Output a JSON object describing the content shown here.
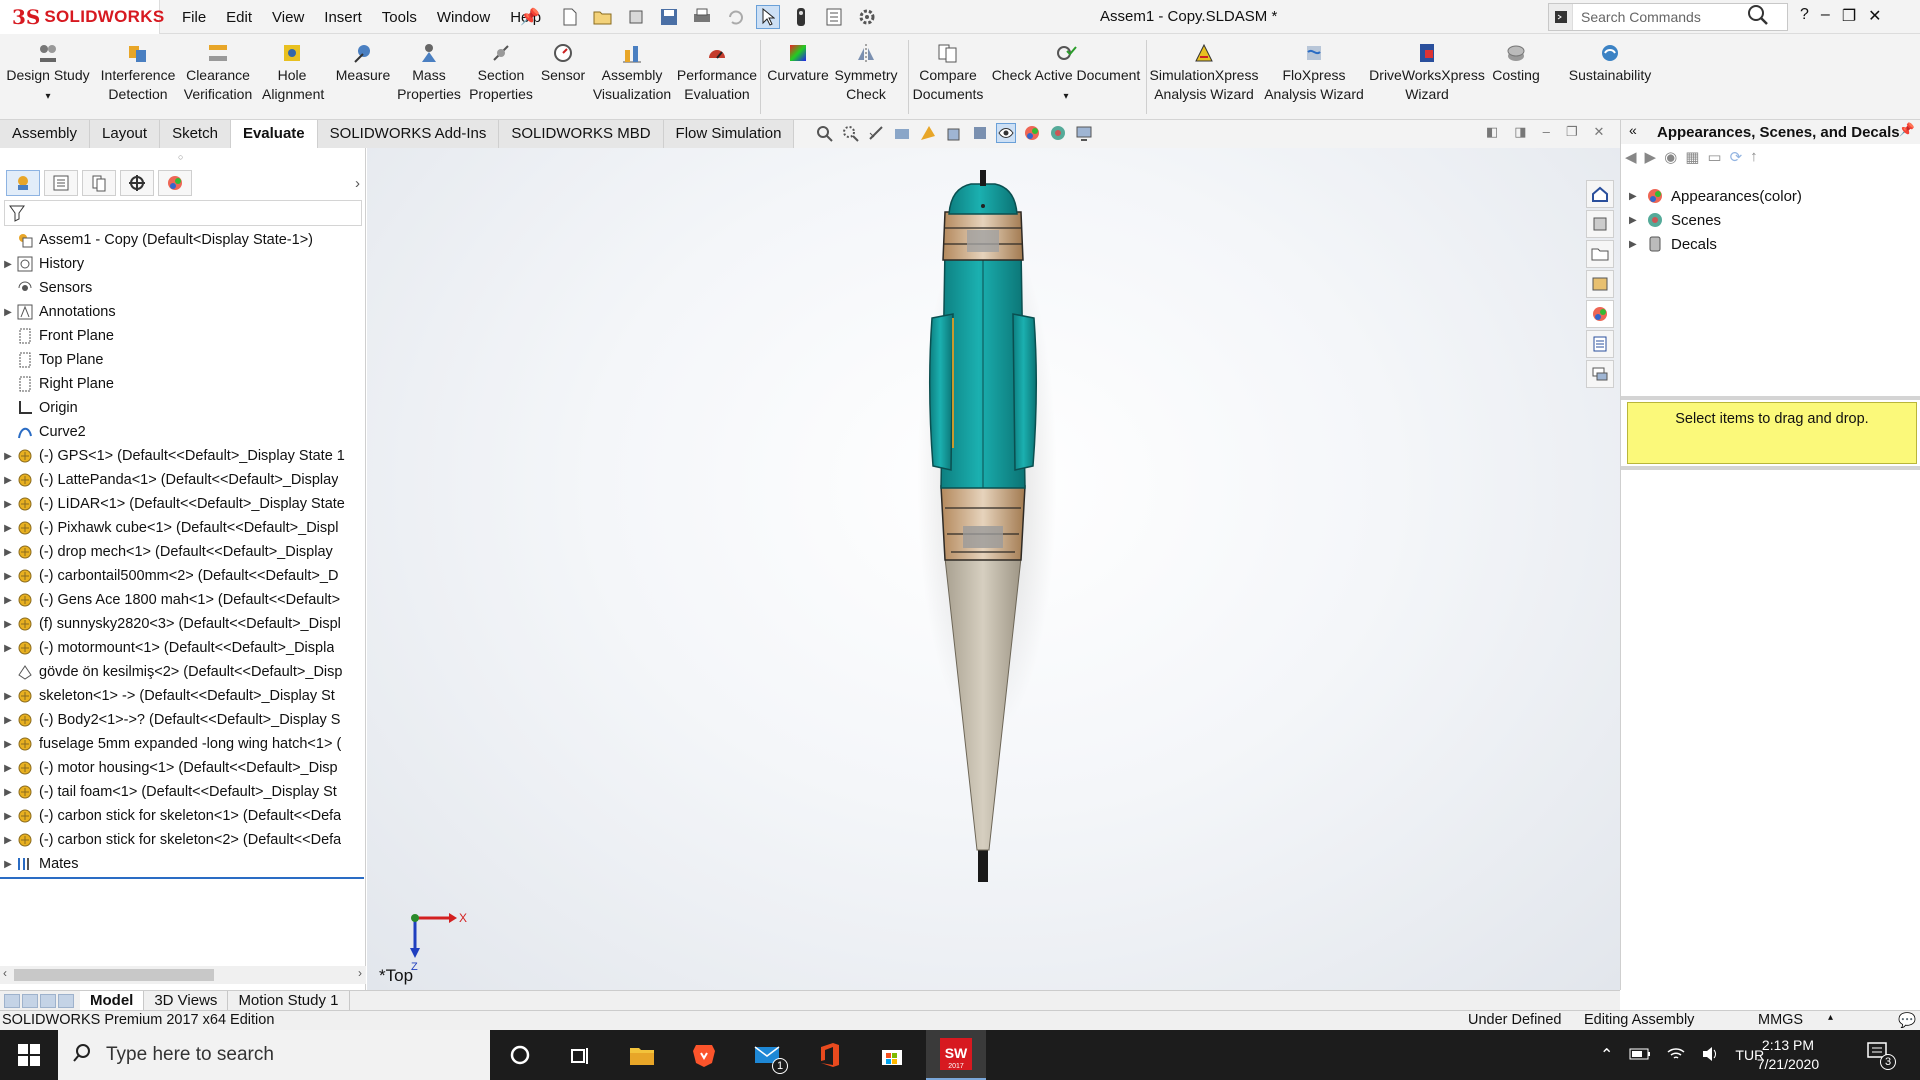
{
  "app": {
    "logo_text": "SOLIDWORKS",
    "menu": [
      "File",
      "Edit",
      "View",
      "Insert",
      "Tools",
      "Window",
      "Help"
    ],
    "doc_title": "Assem1 - Copy.SLDASM *",
    "search_placeholder": "Search Commands"
  },
  "commands": [
    {
      "label": "Design Study",
      "icon": "design-study-icon"
    },
    {
      "label": "Interference Detection",
      "icon": "interference-icon"
    },
    {
      "label": "Clearance Verification",
      "icon": "clearance-icon"
    },
    {
      "label": "Hole Alignment",
      "icon": "hole-alignment-icon"
    },
    {
      "label": "Measure",
      "icon": "measure-icon"
    },
    {
      "label": "Mass Properties",
      "icon": "mass-properties-icon"
    },
    {
      "label": "Section Properties",
      "icon": "section-properties-icon"
    },
    {
      "label": "Sensor",
      "icon": "sensor-icon"
    },
    {
      "label": "Assembly Visualization",
      "icon": "assembly-visualization-icon"
    },
    {
      "label": "Performance Evaluation",
      "icon": "performance-icon"
    },
    {
      "label": "Curvature",
      "icon": "curvature-icon"
    },
    {
      "label": "Symmetry Check",
      "icon": "symmetry-icon"
    },
    {
      "label": "Compare Documents",
      "icon": "compare-icon"
    },
    {
      "label": "Check Active Document",
      "icon": "check-document-icon"
    },
    {
      "label": "SimulationXpress Analysis Wizard",
      "icon": "simulationxpress-icon"
    },
    {
      "label": "FloXpress Analysis Wizard",
      "icon": "floxpress-icon"
    },
    {
      "label": "DriveWorksXpress Wizard",
      "icon": "driveworks-icon"
    },
    {
      "label": "Costing",
      "icon": "costing-icon"
    },
    {
      "label": "Sustainability",
      "icon": "sustainability-icon"
    }
  ],
  "tabs": [
    "Assembly",
    "Layout",
    "Sketch",
    "Evaluate",
    "SOLIDWORKS Add-Ins",
    "SOLIDWORKS MBD",
    "Flow Simulation"
  ],
  "active_tab": "Evaluate",
  "tree": [
    {
      "label": "Assem1 - Copy  (Default<Display State-1>)",
      "icon": "assembly-icon",
      "expand": false
    },
    {
      "label": "History",
      "icon": "history-icon",
      "expand": true
    },
    {
      "label": "Sensors",
      "icon": "sensors-icon",
      "expand": false
    },
    {
      "label": "Annotations",
      "icon": "annotations-icon",
      "expand": true
    },
    {
      "label": "Front Plane",
      "icon": "plane-icon",
      "expand": false
    },
    {
      "label": "Top Plane",
      "icon": "plane-icon",
      "expand": false
    },
    {
      "label": "Right Plane",
      "icon": "plane-icon",
      "expand": false
    },
    {
      "label": "Origin",
      "icon": "origin-icon",
      "expand": false
    },
    {
      "label": "Curve2",
      "icon": "curve-icon",
      "expand": false
    },
    {
      "label": "(-) GPS<1> (Default<<Default>_Display State 1",
      "icon": "part-icon",
      "expand": true
    },
    {
      "label": "(-) LattePanda<1> (Default<<Default>_Display",
      "icon": "part-icon",
      "expand": true
    },
    {
      "label": "(-) LİDAR<1> (Default<<Default>_Display State",
      "icon": "part-icon",
      "expand": true
    },
    {
      "label": "(-) Pixhawk cube<1> (Default<<Default>_Displ",
      "icon": "part-icon",
      "expand": true
    },
    {
      "label": "(-) drop mech<1> (Default<<Default>_Display",
      "icon": "part-icon",
      "expand": true
    },
    {
      "label": "(-) carbontail500mm<2> (Default<<Default>_D",
      "icon": "part-icon",
      "expand": true
    },
    {
      "label": "(-) Gens Ace 1800 mah<1> (Default<<Default>",
      "icon": "part-icon",
      "expand": true
    },
    {
      "label": "(f) sunnysky2820<3> (Default<<Default>_Displ",
      "icon": "part-icon",
      "expand": true
    },
    {
      "label": "(-) motormount<1> (Default<<Default>_Displa",
      "icon": "part-icon",
      "expand": true
    },
    {
      "label": "gövde ön kesilmiş<2> (Default<<Default>_Disp",
      "icon": "body-icon",
      "expand": false
    },
    {
      "label": "skeleton<1> -> (Default<<Default>_Display St",
      "icon": "part-icon",
      "expand": true
    },
    {
      "label": "(-) Body2<1>->? (Default<<Default>_Display S",
      "icon": "part-icon",
      "expand": true
    },
    {
      "label": "fuselage 5mm expanded -long wing hatch<1> (",
      "icon": "part-icon",
      "expand": true
    },
    {
      "label": "(-) motor housing<1> (Default<<Default>_Disp",
      "icon": "part-icon",
      "expand": true
    },
    {
      "label": "(-) tail foam<1> (Default<<Default>_Display St",
      "icon": "part-icon",
      "expand": true
    },
    {
      "label": "(-) carbon stick for skeleton<1> (Default<<Defa",
      "icon": "part-icon",
      "expand": true
    },
    {
      "label": "(-) carbon stick for skeleton<2> (Default<<Defa",
      "icon": "part-icon",
      "expand": true
    },
    {
      "label": "Mates",
      "icon": "mates-icon",
      "expand": true
    }
  ],
  "viewport": {
    "view_name": "*Top",
    "axis_x": "X",
    "axis_z": "Z"
  },
  "taskpane": {
    "title": "Appearances, Scenes, and Decals",
    "items": [
      {
        "label": "Appearances(color)",
        "icon": "appearances-icon"
      },
      {
        "label": "Scenes",
        "icon": "scenes-icon"
      },
      {
        "label": "Decals",
        "icon": "decals-icon"
      }
    ],
    "hint": "Select items to drag and drop."
  },
  "bottom_tabs": [
    "Model",
    "3D Views",
    "Motion Study 1"
  ],
  "status": {
    "edition": "SOLIDWORKS Premium 2017 x64 Edition",
    "state": "Under Defined",
    "mode": "Editing Assembly",
    "units": "MMGS"
  },
  "taskbar": {
    "search_placeholder": "Type here to search",
    "lang": "TUR",
    "time": "2:13 PM",
    "date": "7/21/2020",
    "mail_badge": "1",
    "notif_count": "3",
    "sw_badge": "2017"
  },
  "colors": {
    "accent": "#2a6cc4",
    "brand": "#d71920",
    "model_teal": "#18a3a3",
    "model_cone": "#c9c2b3"
  }
}
